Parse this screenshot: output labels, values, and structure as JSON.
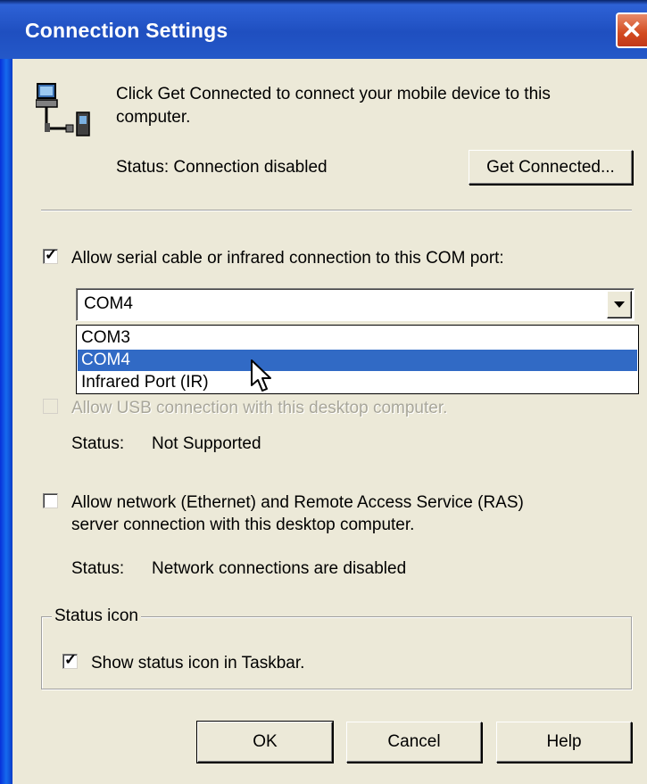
{
  "window": {
    "title": "Connection Settings",
    "close_glyph": "✕"
  },
  "header": {
    "message_line1": "Click Get Connected to connect your mobile device to this",
    "message_line2": "computer.",
    "status": "Status: Connection disabled",
    "get_connected_label": "Get Connected..."
  },
  "serial": {
    "checkbox_label": "Allow serial cable or infrared connection to this COM port:",
    "checked": true,
    "selected_port": "COM4",
    "options": [
      "COM3",
      "COM4",
      "Infrared Port (IR)"
    ]
  },
  "usb": {
    "checkbox_label": "Allow USB connection with this desktop computer.",
    "checked": false,
    "status_label": "Status:",
    "status_value": "Not Supported"
  },
  "network": {
    "checkbox_label_line1": "Allow network (Ethernet) and Remote Access Service (RAS)",
    "checkbox_label_line2": "server connection with this desktop computer.",
    "checked": false,
    "status_label": "Status:",
    "status_value": "Network connections are disabled"
  },
  "status_icon_group": {
    "legend": "Status icon",
    "checkbox_label": "Show status icon in Taskbar.",
    "checked": true
  },
  "footer": {
    "ok_label": "OK",
    "cancel_label": "Cancel",
    "help_label": "Help"
  },
  "icons": {
    "device": "computer-device-icon",
    "close": "close-icon",
    "dropdown_arrow": "chevron-down-icon",
    "cursor": "mouse-pointer-icon"
  },
  "colors": {
    "titlebar": "#2458c8",
    "selection": "#316ac5",
    "dialog_bg": "#ece9d8"
  }
}
